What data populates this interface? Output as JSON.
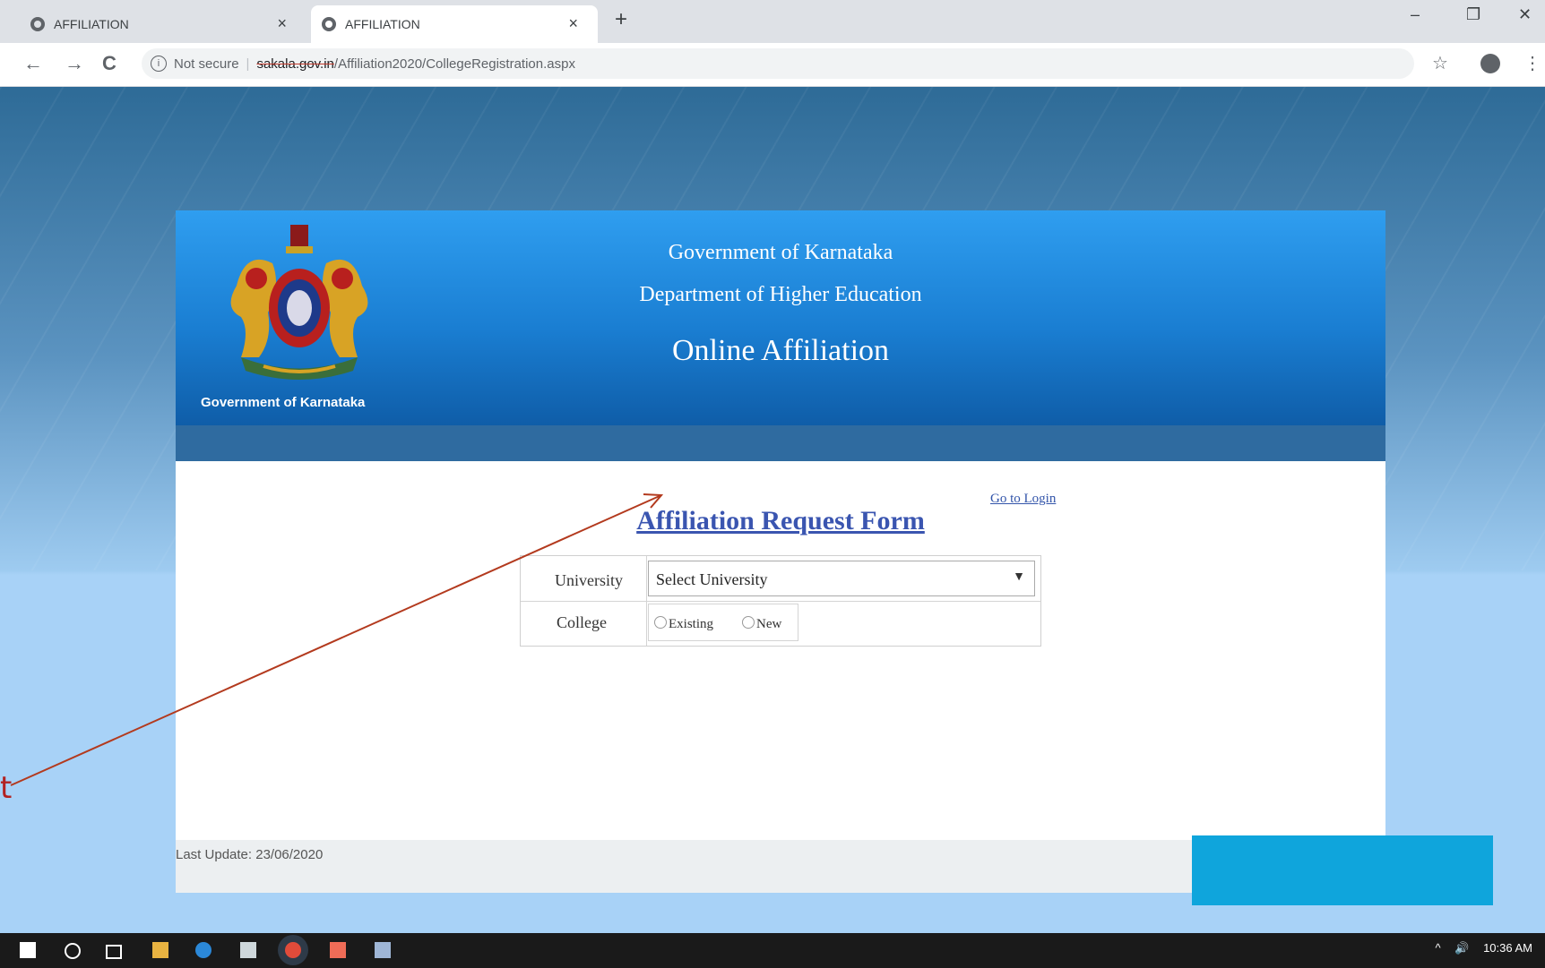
{
  "browser": {
    "tabs": [
      {
        "title": "AFFILIATION",
        "close": "×"
      },
      {
        "title": "AFFILIATION",
        "close": "×"
      }
    ],
    "new_tab": "+",
    "window_controls": {
      "minimize": "–",
      "restore": "❐",
      "close": "✕"
    },
    "nav": {
      "back": "←",
      "forward": "→",
      "reload": "C"
    },
    "address": {
      "info": "i",
      "security": "Not secure",
      "separator": "|",
      "host": "sakala.gov.in",
      "path": "/Affiliation2020/CollegeRegistration.aspx"
    },
    "bookmark_star": "☆",
    "menu": "⋮"
  },
  "header": {
    "emblem_caption": "Government of Karnataka",
    "line1": "Government of Karnataka",
    "line2": "Department of Higher Education",
    "line3": "Online Affiliation"
  },
  "form": {
    "login_link": "Go to Login",
    "title": "Affiliation Request Form",
    "university_label": "University",
    "university_selected": "Select University",
    "college_label": "College",
    "college_options": [
      "Existing",
      "New"
    ]
  },
  "footer": {
    "last_update": "Last Update: 23/06/2020"
  },
  "annotation": {
    "partial_text": "t",
    "arrow_color": "#b33a1e"
  },
  "taskbar": {
    "time": "10:36 AM",
    "tray_up": "^",
    "tray_volume": "🔊"
  }
}
